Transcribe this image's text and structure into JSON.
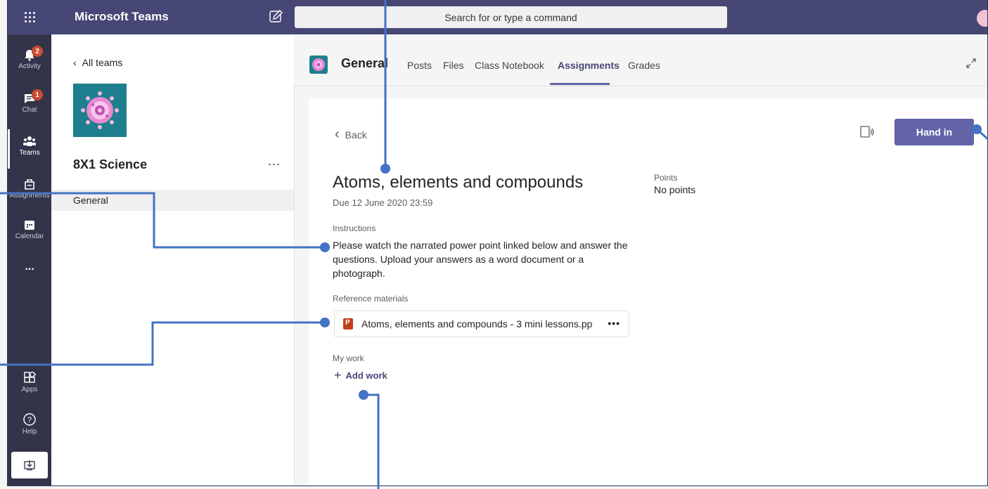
{
  "topbar": {
    "app_title": "Microsoft Teams",
    "search_placeholder": "Search for or type a command"
  },
  "rail": {
    "items": [
      {
        "label": "Activity",
        "badge": "2"
      },
      {
        "label": "Chat",
        "badge": "1"
      },
      {
        "label": "Teams"
      },
      {
        "label": "Assignments"
      },
      {
        "label": "Calendar"
      },
      {
        "label": "..."
      }
    ],
    "bottom_items": [
      {
        "label": "Apps"
      },
      {
        "label": "Help"
      }
    ]
  },
  "teams_panel": {
    "back_label": "All teams",
    "team_name": "8X1 Science",
    "more_label": "...",
    "channel": "General"
  },
  "channel_header": {
    "title": "General",
    "tabs": [
      "Posts",
      "Files",
      "Class Notebook",
      "Assignments",
      "Grades"
    ],
    "active_tab": "Assignments"
  },
  "assignment": {
    "back_label": "Back",
    "hand_in_label": "Hand in",
    "title": "Atoms, elements and compounds",
    "due": "Due 12 June 2020 23:59",
    "points_label": "Points",
    "points_value": "No points",
    "instructions_label": "Instructions",
    "instructions": "Please watch the narrated power point linked below and answer the questions. Upload your answers as a word document or a photograph.",
    "reference_label": "Reference materials",
    "reference_file": "Atoms, elements and compounds - 3 mini lessons.pp",
    "reference_more": "•••",
    "my_work_label": "My work",
    "add_work_label": "Add work"
  },
  "colors": {
    "topbar": "#464775",
    "rail": "#33344a",
    "accent": "#6264a7",
    "annotation": "#4472c4"
  }
}
